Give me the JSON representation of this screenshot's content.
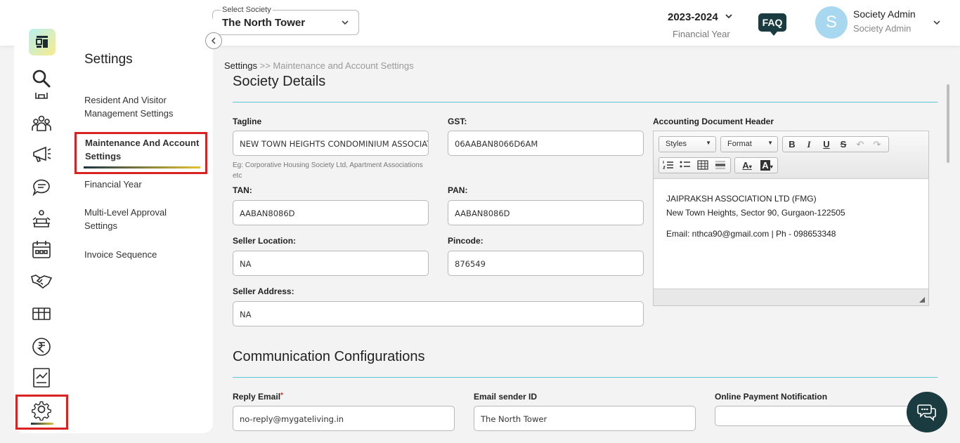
{
  "header": {
    "society_select": {
      "label": "Select Society",
      "value": "The North Tower"
    },
    "financial_year": {
      "value": "2023-2024",
      "label": "Financial Year"
    },
    "faq_label": "FAQ",
    "user": {
      "avatar_letter": "S",
      "name": "Society Admin",
      "role": "Society Admin"
    }
  },
  "rail": {
    "items": [
      "search-icon",
      "home-icon",
      "residents-icon",
      "notices-icon",
      "helpdesk-icon",
      "amenities-icon",
      "calendar-icon",
      "vendors-icon",
      "assets-icon",
      "accounts-icon",
      "reports-icon",
      "settings-icon"
    ],
    "active": "settings-icon"
  },
  "settings_menu": {
    "title": "Settings",
    "items": [
      {
        "label": "Resident And Visitor Management Settings"
      },
      {
        "label": "Maintenance And Account Settings",
        "active": true
      },
      {
        "label": "Financial Year"
      },
      {
        "label": "Multi-Level Approval Settings"
      },
      {
        "label": "Invoice Sequence"
      }
    ]
  },
  "breadcrumb": {
    "root": "Settings",
    "separator": ">>",
    "current": "Maintenance and Account Settings"
  },
  "society_details": {
    "title": "Society Details",
    "tagline": {
      "label": "Tagline",
      "value": "NEW TOWN HEIGHTS CONDOMINIUM ASSOCIATIO",
      "hint": "Eg: Corporative Housing Society Ltd, Apartment Associations etc"
    },
    "gst": {
      "label": "GST:",
      "value": "06AABAN8066D6AM"
    },
    "tan": {
      "label": "TAN:",
      "value": "AABAN8086D"
    },
    "pan": {
      "label": "PAN:",
      "value": "AABAN8086D"
    },
    "seller_location": {
      "label": "Seller Location:",
      "value": "NA"
    },
    "pincode": {
      "label": "Pincode:",
      "value": "876549"
    },
    "seller_address": {
      "label": "Seller Address:",
      "value": "NA"
    },
    "accounting_header": {
      "label": "Accounting Document Header",
      "toolbar": {
        "styles": "Styles",
        "format": "Format",
        "bold": "B",
        "italic": "I",
        "underline": "U",
        "strike": "S"
      },
      "lines": [
        "JAIPRAKSH ASSOCIATION LTD (FMG)",
        "New Town Heights, Sector 90, Gurgaon-122505",
        "Email: nthca90@gmail.com | Ph - 098653348"
      ]
    }
  },
  "communication": {
    "title": "Communication Configurations",
    "reply_email": {
      "label": "Reply Email",
      "required_mark": "*",
      "value": "no-reply@mygateliving.in"
    },
    "email_sender_id": {
      "label": "Email sender ID",
      "value": "The North Tower"
    },
    "online_payment_notification": {
      "label": "Online Payment Notification",
      "value": ""
    }
  },
  "colors": {
    "accent_rule": "#5bc7d6",
    "highlight_border": "#d92222",
    "brand_dark": "#1a3b3f"
  }
}
